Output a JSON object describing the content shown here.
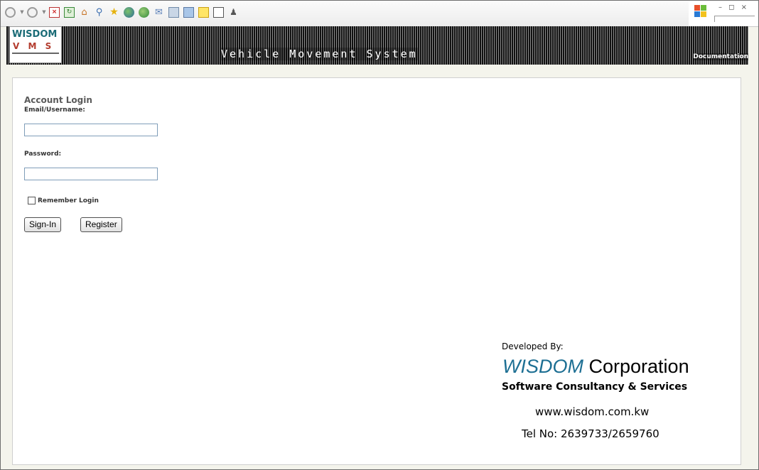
{
  "browser": {
    "toolbar_icons": [
      "back-icon",
      "forward-icon",
      "stop-icon",
      "refresh-icon",
      "home-icon",
      "search-icon",
      "favorites-icon",
      "media-icon",
      "history-icon",
      "mail-icon",
      "print-icon",
      "edit-icon",
      "discuss-icon",
      "research-icon",
      "messenger-icon"
    ],
    "window_controls": "– ◻ ×"
  },
  "header": {
    "logo_top": "WISDOM",
    "logo_bottom": "V M S",
    "title": "Vehicle Movement System",
    "documentation_link": "Documentation"
  },
  "login": {
    "title": "Account Login",
    "username_label": "Email/Username:",
    "username_value": "",
    "password_label": "Password:",
    "password_value": "",
    "remember_label": "Remember Login",
    "remember_checked": false,
    "signin_label": "Sign-In",
    "register_label": "Register"
  },
  "credits": {
    "developed_by": "Developed By:",
    "brand": "WISDOM",
    "corporation": " Corporation",
    "tagline": "Software Consultancy & Services",
    "website": "www.wisdom.com.kw",
    "tel": "Tel No: 2639733/2659760"
  },
  "colors": {
    "brand_blue": "#1d6f93",
    "logo_teal": "#1b6c77",
    "logo_red": "#b33c2e"
  }
}
